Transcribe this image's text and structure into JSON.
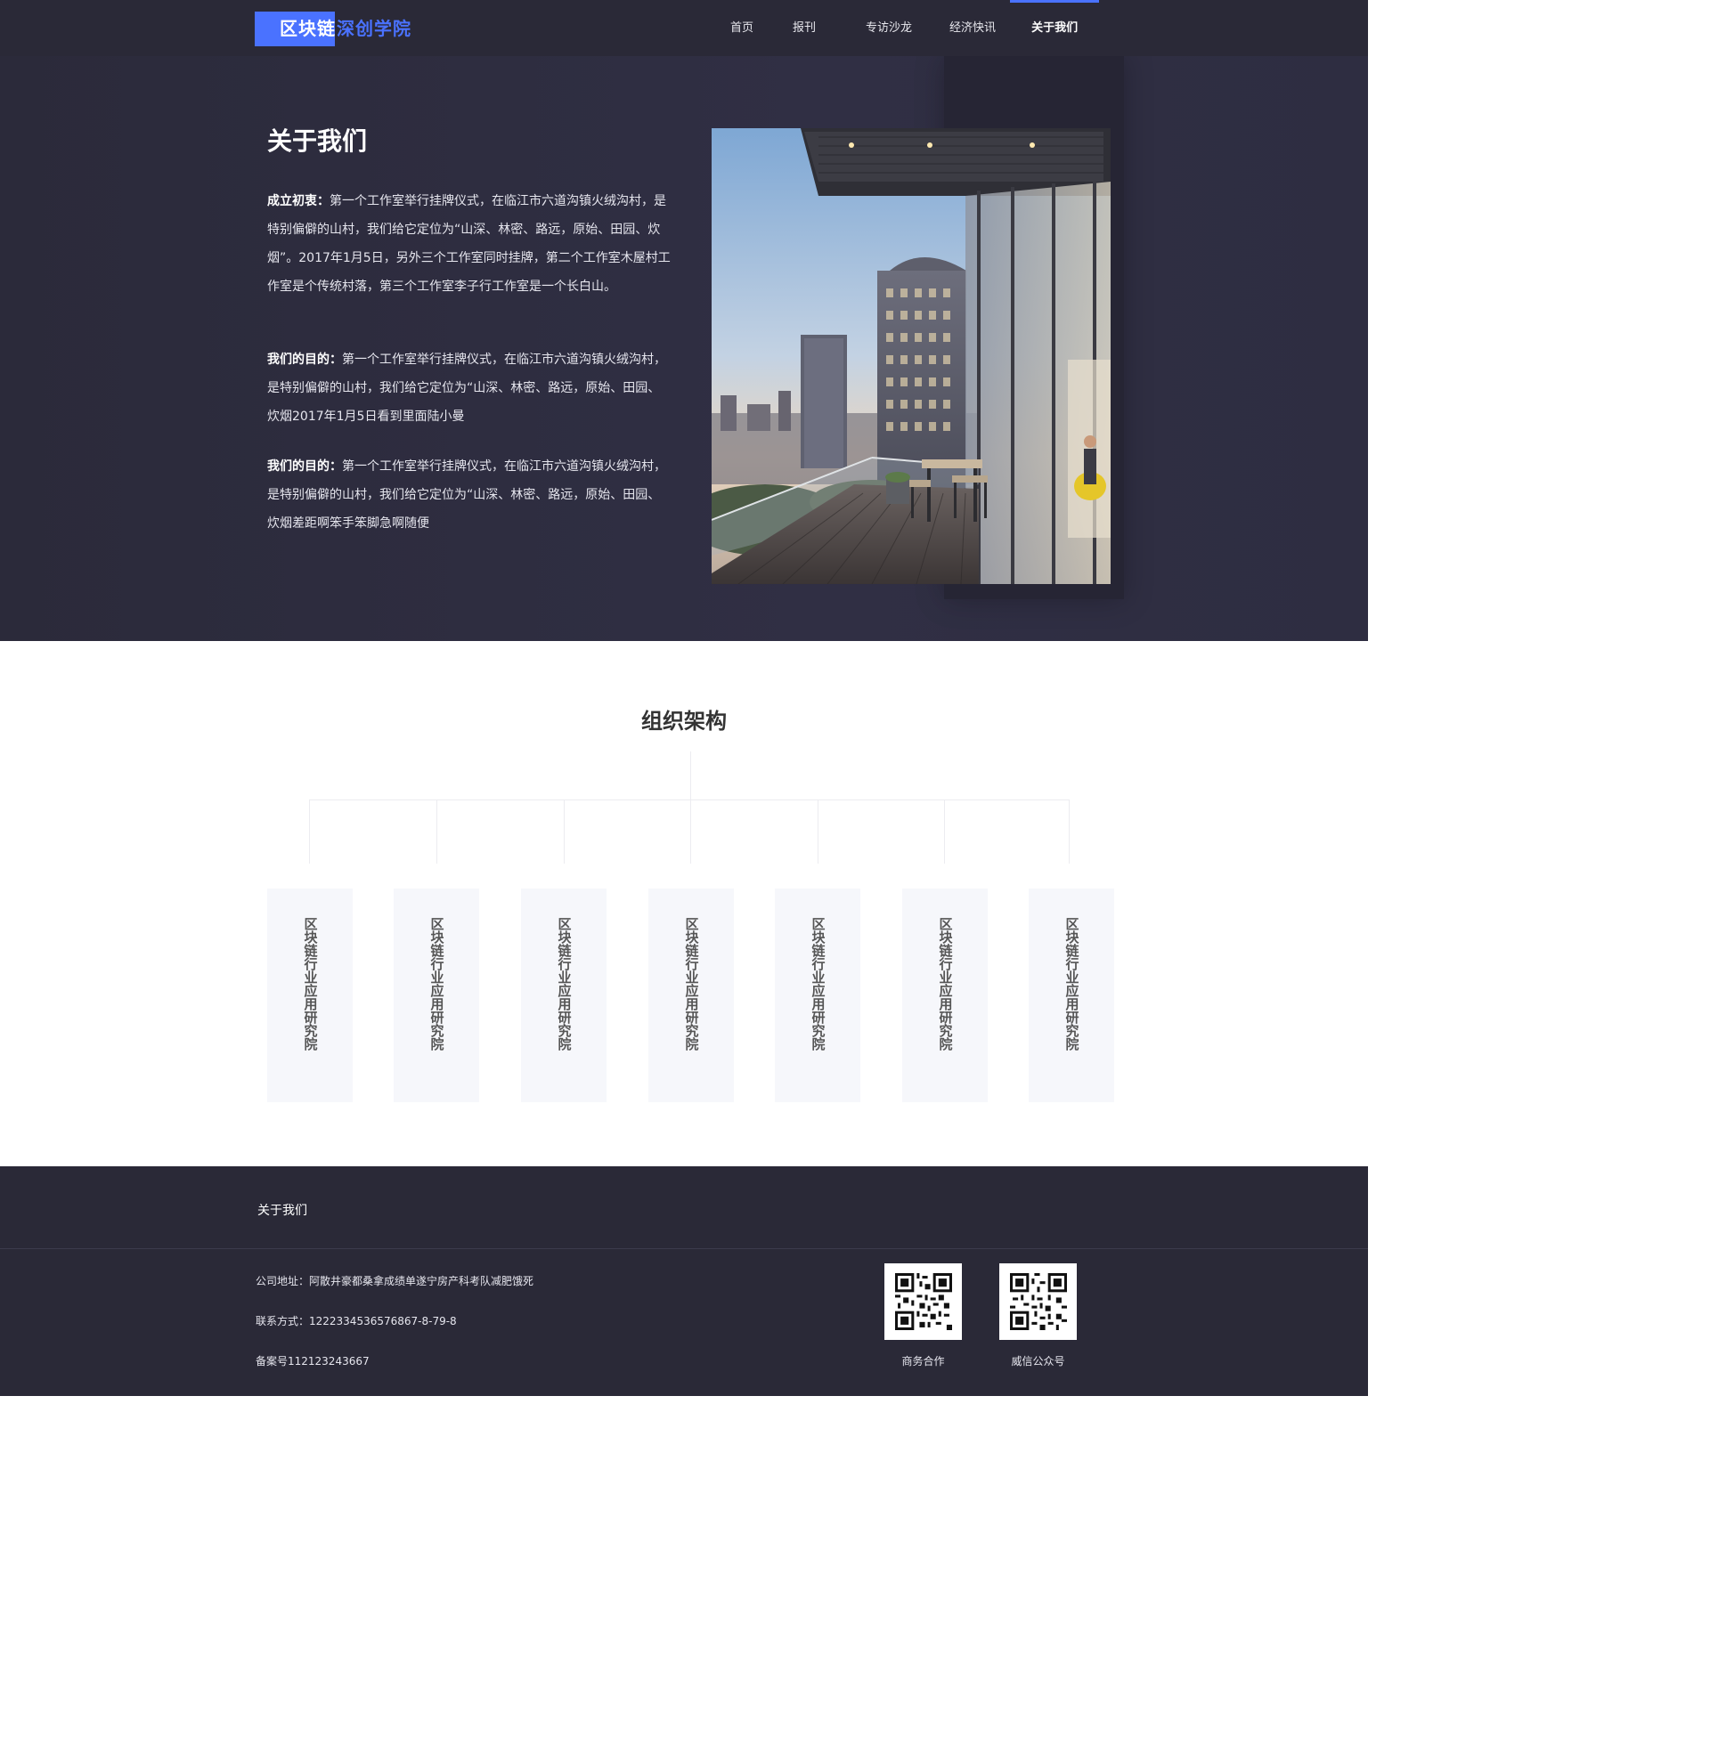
{
  "header": {
    "logo_main": "区块链",
    "logo_sub": "深创学院",
    "nav": [
      {
        "label": "首页"
      },
      {
        "label": "报刊"
      },
      {
        "label": "专访沙龙"
      },
      {
        "label": "经济快讯"
      },
      {
        "label": "关于我们"
      }
    ],
    "active_nav": "关于我们"
  },
  "hero": {
    "title": "关于我们",
    "paragraphs": [
      {
        "lead": "成立初衷：",
        "body": "第一个工作室举行挂牌仪式，在临江市六道沟镇火绒沟村，是特别偏僻的山村，我们给它定位为“山深、林密、路远，原始、田园、炊烟”。2017年1月5日，另外三个工作室同时挂牌，第二个工作室木屋村工作室是个传统村落，第三个工作室李子行工作室是一个长白山。"
      },
      {
        "lead": "我们的目的：",
        "body": "第一个工作室举行挂牌仪式，在临江市六道沟镇火绒沟村，是特别偏僻的山村，我们给它定位为“山深、林密、路远，原始、田园、炊烟2017年1月5日看到里面陆小曼"
      },
      {
        "lead": "我们的目的：",
        "body": "第一个工作室举行挂牌仪式，在临江市六道沟镇火绒沟村，是特别偏僻的山村，我们给它定位为“山深、林密、路远，原始、田园、炊烟差距啊笨手笨脚急啊随便"
      }
    ]
  },
  "org": {
    "title": "组织架构",
    "cards": [
      "区块链行业应用研究院",
      "区块链行业应用研究院",
      "区块链行业应用研究院",
      "区块链行业应用研究院",
      "区块链行业应用研究院",
      "区块链行业应用研究院",
      "区块链行业应用研究院"
    ]
  },
  "footer": {
    "title": "关于我们",
    "address": "公司地址：阿散井豪都桑拿成绩单遂宁房产科考队减肥饿死",
    "contact": "联系方式：1222334536576867-8-79-8",
    "record": "备案号112123243667",
    "qr_labels": [
      "商务合作",
      "威信公众号"
    ]
  },
  "colors": {
    "accent": "#4a72ff",
    "dark_bg": "#2a2937",
    "hero_bg": "#2e2d41",
    "card_bg": "#f6f7fb"
  }
}
